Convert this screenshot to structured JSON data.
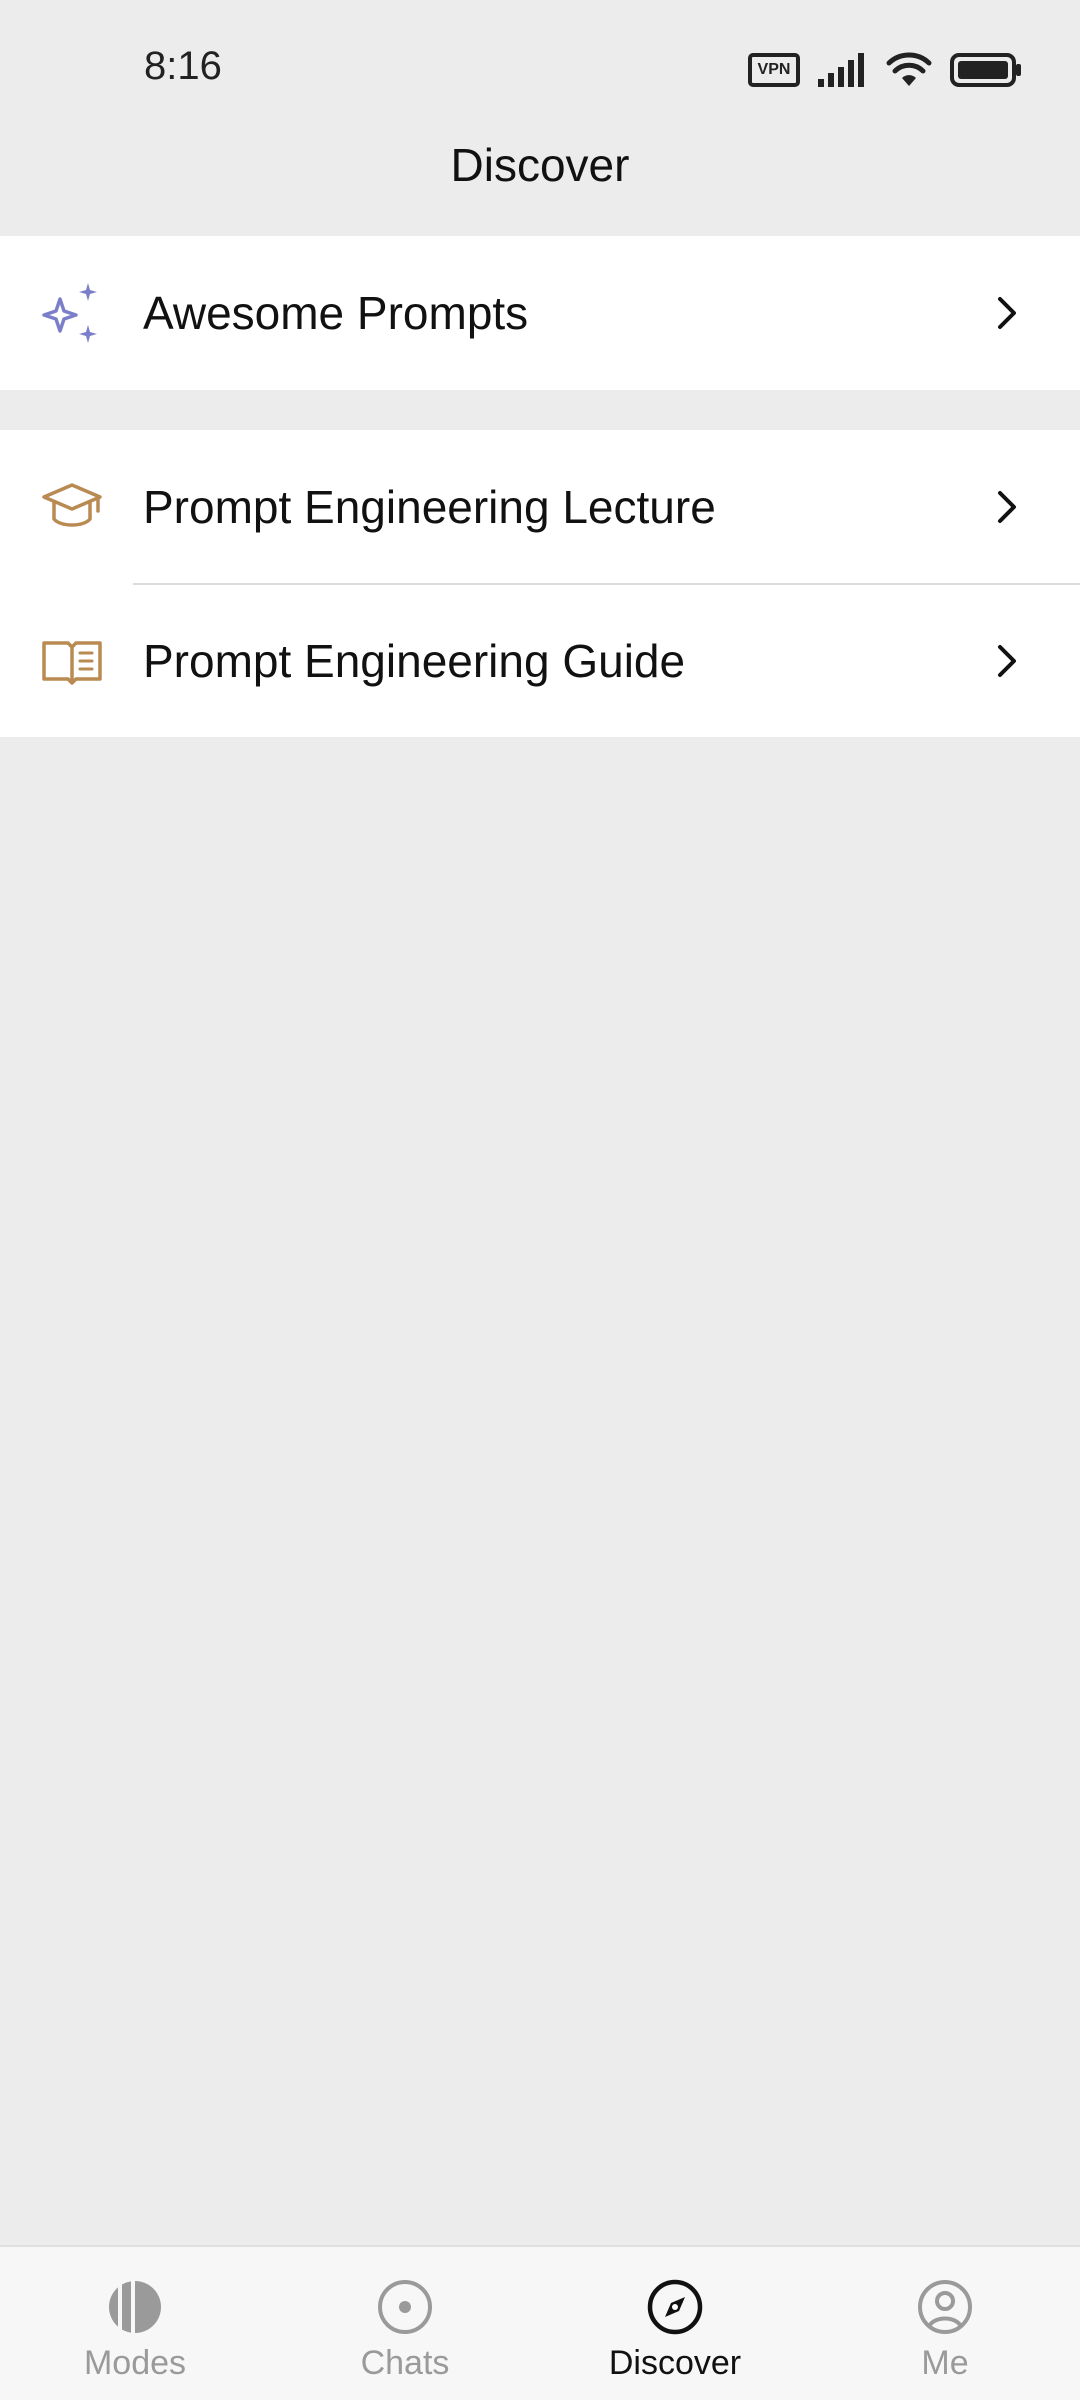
{
  "status_bar": {
    "time": "8:16",
    "vpn_label": "VPN",
    "icons": [
      "vpn-icon",
      "signal-icon",
      "wifi-icon",
      "battery-icon"
    ]
  },
  "header": {
    "title": "Discover"
  },
  "list": {
    "groups": [
      {
        "items": [
          {
            "label": "Awesome Prompts",
            "icon": "sparkles-icon",
            "icon_color": "#7b7fc9"
          }
        ]
      },
      {
        "items": [
          {
            "label": "Prompt Engineering Lecture",
            "icon": "graduation-cap-icon",
            "icon_color": "#b98a52"
          },
          {
            "label": "Prompt Engineering Guide",
            "icon": "open-book-icon",
            "icon_color": "#b98a52"
          }
        ]
      }
    ]
  },
  "bottom_nav": {
    "items": [
      {
        "label": "Modes",
        "icon": "modes-icon",
        "active": false
      },
      {
        "label": "Chats",
        "icon": "chats-icon",
        "active": false
      },
      {
        "label": "Discover",
        "icon": "compass-icon",
        "active": true
      },
      {
        "label": "Me",
        "icon": "profile-icon",
        "active": false
      }
    ]
  },
  "colors": {
    "background": "#ececec",
    "card": "#ffffff",
    "accent_purple": "#7b7fc9",
    "accent_gold": "#b98a52",
    "inactive_nav": "#9a9a9a"
  }
}
